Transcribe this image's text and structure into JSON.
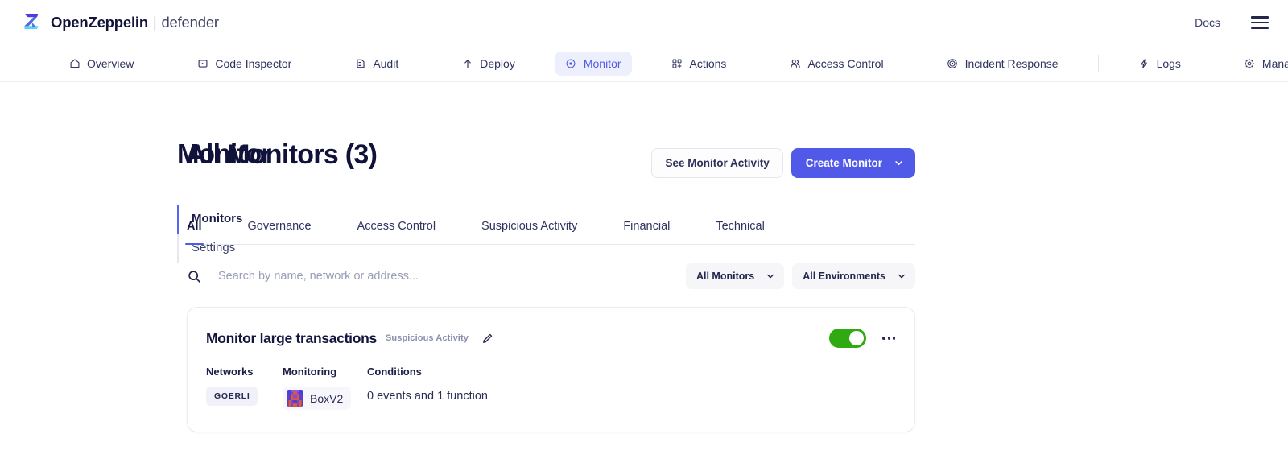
{
  "brand": {
    "logo_icon": "openzeppelin-z-logo",
    "name": "OpenZeppelin",
    "separator": "|",
    "product": "defender"
  },
  "topbar": {
    "docs_label": "Docs",
    "menu_icon": "hamburger-menu-icon"
  },
  "nav": {
    "items": [
      {
        "label": "Overview",
        "icon": "home-icon",
        "active": false
      },
      {
        "label": "Code Inspector",
        "icon": "code-inspector-icon",
        "active": false
      },
      {
        "label": "Audit",
        "icon": "audit-document-icon",
        "active": false
      },
      {
        "label": "Deploy",
        "icon": "arrow-up-icon",
        "active": false
      },
      {
        "label": "Monitor",
        "icon": "target-icon",
        "active": true
      },
      {
        "label": "Actions",
        "icon": "actions-grid-icon",
        "active": false
      },
      {
        "label": "Access Control",
        "icon": "users-icon",
        "active": false
      },
      {
        "label": "Incident Response",
        "icon": "concentric-circles-icon",
        "active": false
      },
      {
        "label": "Logs",
        "icon": "lightning-icon",
        "active": false
      },
      {
        "label": "Manage",
        "icon": "gear-icon",
        "active": false
      }
    ]
  },
  "sidebar": {
    "section_title": "Monitor",
    "items": [
      {
        "label": "Monitors",
        "active": true
      },
      {
        "label": "Settings",
        "active": false
      }
    ]
  },
  "main": {
    "page_title": "All Monitors (3)",
    "see_activity_label": "See Monitor Activity",
    "create_monitor_label": "Create Monitor",
    "create_monitor_caret_icon": "chevron-down-icon",
    "tabs": [
      {
        "label": "All",
        "active": true
      },
      {
        "label": "Governance",
        "active": false
      },
      {
        "label": "Access Control",
        "active": false
      },
      {
        "label": "Suspicious Activity",
        "active": false
      },
      {
        "label": "Financial",
        "active": false
      },
      {
        "label": "Technical",
        "active": false
      }
    ],
    "search": {
      "icon": "search-icon",
      "placeholder": "Search by name, network or address...",
      "value": ""
    },
    "filters": [
      {
        "label": "All Monitors",
        "icon": "chevron-down-icon"
      },
      {
        "label": "All Environments",
        "icon": "chevron-down-icon"
      }
    ],
    "monitors": [
      {
        "title": "Monitor large transactions",
        "category": "Suspicious Activity",
        "edit_icon": "pencil-edit-icon",
        "enabled": true,
        "more_icon": "kebab-menu-icon",
        "columns": {
          "networks_label": "Networks",
          "networks": [
            "GOERLI"
          ],
          "monitoring_label": "Monitoring",
          "monitoring_contract": "BoxV2",
          "monitoring_avatar_icon": "contract-identicon",
          "conditions_label": "Conditions",
          "conditions_text": "0 events and 1 function"
        }
      }
    ]
  },
  "colors": {
    "accent": "#5159e8",
    "nav_active_bg": "#eeeffc",
    "toggle_on": "#2faa11",
    "text_dark": "#13163c",
    "text_muted": "#8a8fad",
    "border": "#eaeaf1"
  }
}
